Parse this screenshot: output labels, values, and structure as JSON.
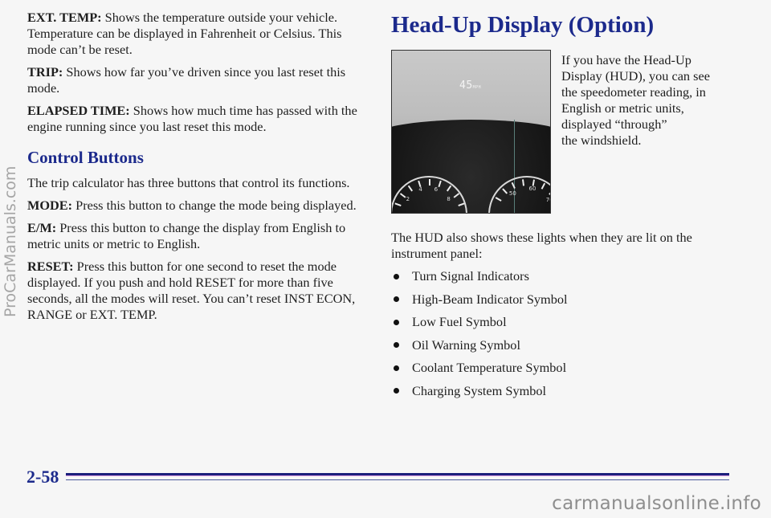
{
  "left_column": {
    "paragraphs_top": [
      {
        "term": "EXT. TEMP:",
        "text": " Shows the temperature outside your vehicle. Temperature can be displayed in Fahrenheit or Celsius. This mode can’t be reset."
      },
      {
        "term": "TRIP:",
        "text": " Shows how far you’ve driven since you last reset this mode."
      },
      {
        "term": "ELAPSED TIME:",
        "text": " Shows how much time has passed with the engine running since you last reset this mode."
      }
    ],
    "section_heading": "Control Buttons",
    "intro": "The trip calculator has three buttons that control its functions.",
    "buttons": [
      {
        "term": "MODE:",
        "text": " Press this button to change the mode being displayed."
      },
      {
        "term": "E/M:",
        "text": " Press this button to change the display from English to metric units or metric to English."
      },
      {
        "term": "RESET:",
        "text": " Press this button for one second to reset the mode displayed. If you push and hold RESET for more than five seconds, all the modes will reset. You can’t reset INST ECON, RANGE or EXT. TEMP."
      }
    ]
  },
  "right_column": {
    "title": "Head-Up Display (Option)",
    "photo": {
      "description": "Windshield head-up display above instrument cluster",
      "hud_speed": "45",
      "hud_unit": "MPH",
      "left_gauge_labels": [
        "2",
        "4",
        "6",
        "8"
      ],
      "right_gauge_labels": [
        "50",
        "60",
        "70"
      ]
    },
    "photo_caption_lines": [
      "If you have the Head-Up",
      "Display (HUD), you can see",
      "the speedometer reading, in",
      "English or metric units,",
      "displayed “through”",
      "the windshield."
    ],
    "lights_intro": "The HUD also shows these lights when they are lit on the instrument panel:",
    "lights": [
      "Turn Signal Indicators",
      "High-Beam Indicator Symbol",
      "Low Fuel Symbol",
      "Oil Warning Symbol",
      "Coolant Temperature Symbol",
      "Charging System Symbol"
    ]
  },
  "footer": {
    "page_number": "2-58"
  },
  "watermarks": {
    "side": "ProCarManuals.com",
    "bottom": "carmanualsonline.info"
  },
  "colors": {
    "heading": "#1c2a8c",
    "rule": "#1b1f7c",
    "background": "#f6f6f6"
  }
}
